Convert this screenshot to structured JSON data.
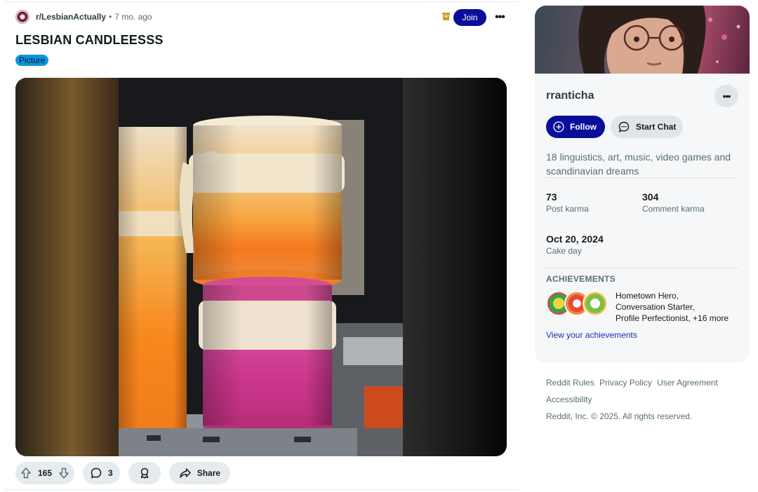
{
  "post": {
    "subreddit": "r/LesbianActually",
    "separator": "•",
    "time": "7 mo. ago",
    "join_label": "Join",
    "more_label": "•••",
    "title": "LESBIAN CANDLEESSS",
    "flair": "Picture",
    "image_icon": "candles-photo",
    "actions": {
      "upvotes": "165",
      "comments": "3",
      "share": "Share"
    }
  },
  "sidebar": {
    "username": "rranticha",
    "more_label": "•••",
    "follow_label": "Follow",
    "chat_label": "Start Chat",
    "bio": "18 linguistics, art, music, video games and scandinavian dreams",
    "post_karma": "73",
    "post_karma_label": "Post karma",
    "comment_karma": "304",
    "comment_karma_label": "Comment karma",
    "cake_day": "Oct 20, 2024",
    "cake_day_label": "Cake day",
    "achievements_title": "ACHIEVEMENTS",
    "achievements_lines": [
      "Hometown Hero,",
      "Conversation Starter,",
      "Profile Perfectionist, +16 more"
    ],
    "achievements_link": "View your achievements"
  },
  "footer": {
    "links": [
      "Reddit Rules",
      "Privacy Policy",
      "User Agreement",
      "Accessibility"
    ],
    "copyright": "Reddit, Inc. © 2025. All rights reserved."
  },
  "colors": {
    "accent": "#0a0e9a",
    "flair": "#0f93e0",
    "pill": "#e5ebee"
  }
}
